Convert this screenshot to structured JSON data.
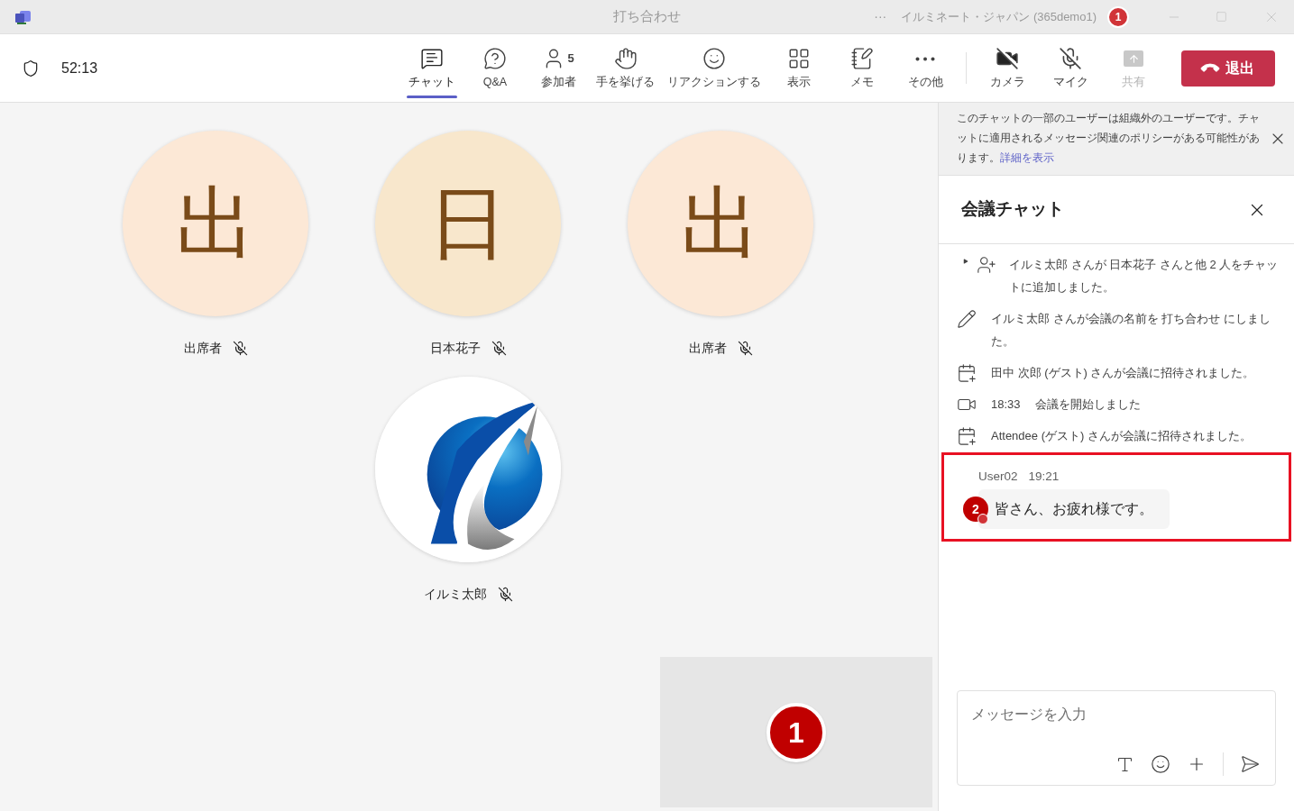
{
  "title_bar": {
    "title": "打ち合わせ",
    "more": "···",
    "account": "イルミネート・ジャパン (365demo1)",
    "annotation_badge": "1"
  },
  "toolbar": {
    "timer": "52:13",
    "items": [
      {
        "kind": "chat",
        "label": "チャット",
        "selected": true
      },
      {
        "kind": "qa",
        "label": "Q&A",
        "selected": false
      },
      {
        "kind": "people",
        "label": "参加者",
        "count": "5",
        "selected": false
      },
      {
        "kind": "hand",
        "label": "手を挙げる",
        "selected": false
      },
      {
        "kind": "reaction",
        "label": "リアクションする",
        "selected": false
      },
      {
        "kind": "view",
        "label": "表示",
        "selected": false
      },
      {
        "kind": "notes",
        "label": "メモ",
        "selected": false
      },
      {
        "kind": "more",
        "label": "その他",
        "selected": false
      }
    ],
    "devices": [
      {
        "kind": "camera",
        "label": "カメラ",
        "off": true,
        "disabled": false
      },
      {
        "kind": "mic",
        "label": "マイク",
        "off": true,
        "disabled": false
      },
      {
        "kind": "share",
        "label": "共有",
        "disabled": true
      }
    ],
    "leave": "退出"
  },
  "participants": [
    {
      "kind": "initial",
      "initial": "出",
      "color": "#fce8d6",
      "name": "出席者",
      "muted": true
    },
    {
      "kind": "initial",
      "initial": "日",
      "color": "#f8e7cc",
      "name": "日本花子",
      "muted": true
    },
    {
      "kind": "initial",
      "initial": "出",
      "color": "#fce8d6",
      "name": "出席者",
      "muted": true
    },
    {
      "kind": "picture",
      "name": "イルミ太郎",
      "muted": true
    }
  ],
  "self_view": {
    "annotation_badge": "1"
  },
  "notice": {
    "text": "このチャットの一部のユーザーは組織外のユーザーです。チャットに適用されるメッセージ関連のポリシーがある可能性があります。",
    "link": "詳細を表示"
  },
  "chat": {
    "title": "会議チャット",
    "events": [
      {
        "kind": "added",
        "text": "イルミ太郎 さんが 日本花子 さんと他 2 人をチャットに追加しました。"
      },
      {
        "kind": "renamed",
        "text": "イルミ太郎 さんが会議の名前を 打ち合わせ にしました。"
      },
      {
        "kind": "invited",
        "text": "田中 次郎 (ゲスト) さんが会議に招待されました。"
      },
      {
        "kind": "started",
        "time": "18:33",
        "text": "会議を開始しました"
      },
      {
        "kind": "invited",
        "text": "Attendee (ゲスト) さんが会議に招待されました。"
      }
    ],
    "message": {
      "sender": "User02",
      "time": "19:21",
      "text": "皆さん、お疲れ様です。",
      "annotation_badge": "2",
      "highlighted": true
    },
    "compose": {
      "placeholder": "メッセージを入力"
    }
  }
}
